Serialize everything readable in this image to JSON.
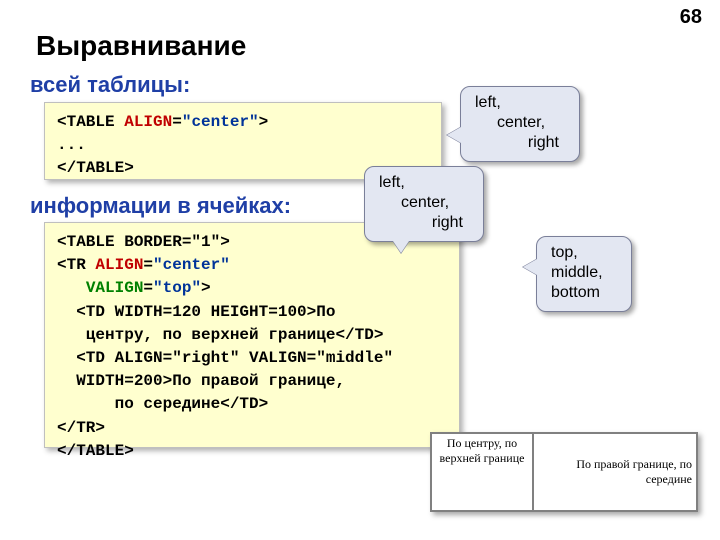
{
  "page_number": "68",
  "title": "Выравнивание",
  "subtitle_table": "всей таблицы:",
  "subtitle_cells": "информации в ячейках:",
  "code1": {
    "l1a": "<TABLE ",
    "l1b": "ALIGN",
    "l1c": "=",
    "l1d": "\"center\"",
    "l1e": ">",
    "l2": "...",
    "l3": "</TABLE>"
  },
  "code2": {
    "l1": "<TABLE BORDER=\"1\">",
    "l2a": "<TR ",
    "l2b": "ALIGN",
    "l2c": "=",
    "l2d": "\"center\"",
    "l3a": "   ",
    "l3b": "VALIGN",
    "l3c": "=",
    "l3d": "\"top\"",
    "l3e": ">",
    "l4": "  <TD WIDTH=120 HEIGHT=100>По",
    "l5": "   центру, по верхней границе</TD>",
    "l6": "  <TD ALIGN=\"right\" VALIGN=\"middle\"",
    "l7": "  WIDTH=200>По правой границе,",
    "l8": "      по середине</TD>",
    "l9": "</TR>",
    "l10": "</TABLE>"
  },
  "callouts": {
    "align1": {
      "a": "left,",
      "b": "center,",
      "c": "right"
    },
    "align2": {
      "a": "left,",
      "b": "center,",
      "c": "right"
    },
    "valign": {
      "a": "top,",
      "b": "middle,",
      "c": "bottom"
    }
  },
  "render": {
    "cell1": "По центру, по верхней границе",
    "cell2": "По правой границе, по середине"
  }
}
